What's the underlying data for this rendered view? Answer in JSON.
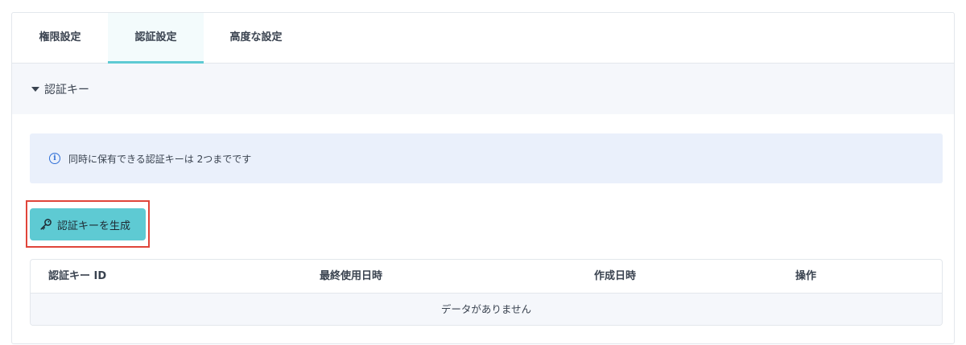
{
  "tabs": [
    {
      "label": "権限設定",
      "active": false
    },
    {
      "label": "認証設定",
      "active": true
    },
    {
      "label": "高度な設定",
      "active": false
    }
  ],
  "section": {
    "title": "認証キー",
    "expanded": true,
    "caret_icon": "caret-down-icon"
  },
  "info": {
    "icon": "info-icon",
    "text": "同時に保有できる認証キーは 2つまでです"
  },
  "generate_button": {
    "label": "認証キーを生成",
    "icon": "key-icon"
  },
  "table": {
    "columns": [
      "認証キー ID",
      "最終使用日時",
      "作成日時",
      "操作"
    ],
    "rows": [],
    "empty_text": "データがありません"
  },
  "colors": {
    "accent": "#5ecad3",
    "highlight_border": "#e0453a",
    "info_bg": "#eaf0fb",
    "info_icon": "#2f6fd6"
  }
}
